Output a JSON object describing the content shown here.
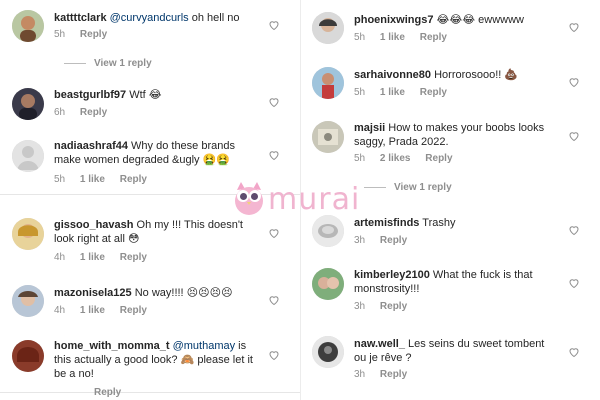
{
  "watermark": {
    "text": "murai",
    "icon": "owl-logo"
  },
  "left_comments": [
    {
      "username": "kattttclark",
      "mention": "@curvyandcurls",
      "text": " oh hell no",
      "time": "5h",
      "likes": "",
      "reply": "Reply",
      "view_replies": "View 1 reply"
    },
    {
      "username": "beastgurlbf97",
      "mention": "",
      "text": " Wtf 😂",
      "time": "6h",
      "likes": "",
      "reply": "Reply"
    },
    {
      "username": "nadiaashraf44",
      "mention": "",
      "text": " Why do these brands make women degraded &ugly 🤮🤮",
      "time": "5h",
      "likes": "1 like",
      "reply": "Reply"
    },
    {
      "username": "gissoo_havash",
      "mention": "",
      "text": " Oh my !!! This doesn't look right at all 😳",
      "time": "4h",
      "likes": "1 like",
      "reply": "Reply"
    },
    {
      "username": "mazonisela125",
      "mention": "",
      "text": " No way!!!! 😣😣😣😣",
      "time": "4h",
      "likes": "1 like",
      "reply": "Reply"
    },
    {
      "username": "home_with_momma_t",
      "mention": "@muthamay",
      "text": " is this actually a good look? 🙈 please let it be a no!",
      "time": "",
      "likes": "",
      "reply": "Reply"
    }
  ],
  "right_comments": [
    {
      "username": "phoenixwings7",
      "mention": "",
      "text": " 😂😂😂 ewwwww",
      "time": "5h",
      "likes": "1 like",
      "reply": "Reply"
    },
    {
      "username": "sarhaivonne80",
      "mention": "",
      "text": " Horrorosooo!! 💩",
      "time": "5h",
      "likes": "1 like",
      "reply": "Reply"
    },
    {
      "username": "majsii",
      "mention": "",
      "text": " How to makes your boobs looks saggy, Prada 2022.",
      "time": "5h",
      "likes": "2 likes",
      "reply": "Reply",
      "view_replies": "View 1 reply"
    },
    {
      "username": "artemisfinds",
      "mention": "",
      "text": " Trashy",
      "time": "3h",
      "likes": "",
      "reply": "Reply"
    },
    {
      "username": "kimberley2100",
      "mention": "",
      "text": " What the fuck is that monstrosity!!!",
      "time": "3h",
      "likes": "",
      "reply": "Reply"
    },
    {
      "username": "naw.well_",
      "mention": "",
      "text": " Les seins du sweet tombent ou je rêve ?",
      "time": "3h",
      "likes": "",
      "reply": "Reply"
    }
  ]
}
